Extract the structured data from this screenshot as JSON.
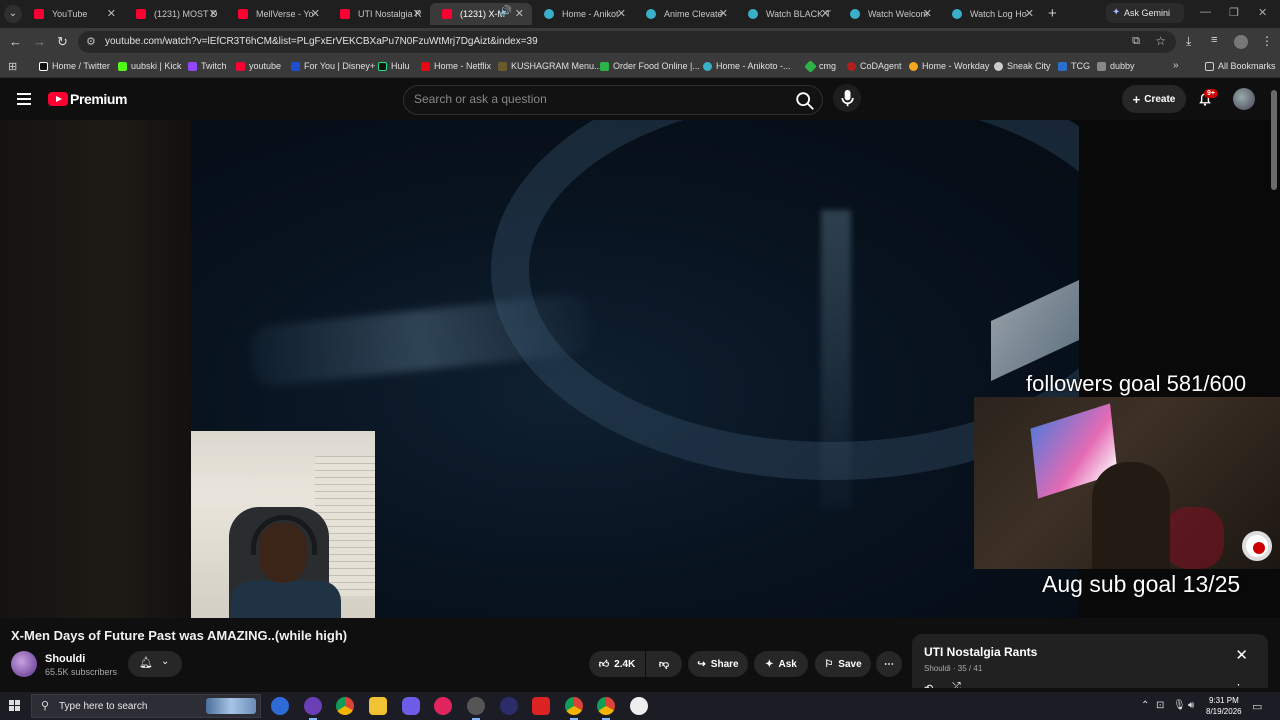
{
  "browser": {
    "tabs": [
      {
        "label": "YouTube",
        "favicon": "youtube-icon",
        "active": false
      },
      {
        "label": "(1231) MOST D",
        "favicon": "youtube-icon",
        "active": false
      },
      {
        "label": "MellVerse - Yo",
        "favicon": "youtube-icon",
        "active": false
      },
      {
        "label": "UTI Nostalgia R",
        "favicon": "youtube-icon",
        "active": false
      },
      {
        "label": "(1231) X-M",
        "favicon": "youtube-icon",
        "active": true
      },
      {
        "label": "Home - Anikot",
        "favicon": "anikoto-icon",
        "active": false
      },
      {
        "label": "Anime Clevate",
        "favicon": "anikoto-icon",
        "active": false
      },
      {
        "label": "Watch BLACK T",
        "favicon": "anikoto-icon",
        "active": false
      },
      {
        "label": "Watch Welcom",
        "favicon": "anikoto-icon",
        "active": false
      },
      {
        "label": "Watch Log Ho",
        "favicon": "anikoto-icon",
        "active": false
      }
    ],
    "gemini_label": "Ask Gemini",
    "url": "youtube.com/watch?v=lEfCR3T6hCM&list=PLgFxErVEKCBXaPu7N0FzuWtMrj7DgAizt&index=39",
    "bookmarks": [
      {
        "label": "Home / Twitter",
        "color": "#ffffff"
      },
      {
        "label": "uubski | Kick",
        "color": "#53fc18"
      },
      {
        "label": "Twitch",
        "color": "#9146ff"
      },
      {
        "label": "youtube",
        "color": "#ff0033"
      },
      {
        "label": "For You | Disney+",
        "color": "#1f4fd0"
      },
      {
        "label": "Hulu",
        "color": "#1ce783"
      },
      {
        "label": "Home - Netflix",
        "color": "#e50914"
      },
      {
        "label": "KUSHAGRAM Menu...",
        "color": "#6b5a2a"
      },
      {
        "label": "Order Food Online |...",
        "color": "#2cb34a"
      },
      {
        "label": "Home - Anikoto -...",
        "color": "#3ab0c8"
      },
      {
        "label": "cmg",
        "color": "#2cb34a"
      },
      {
        "label": "CoDAgent",
        "color": "#b01e1e"
      },
      {
        "label": "Home - Workday",
        "color": "#f5a623"
      },
      {
        "label": "Sneak City",
        "color": "#cccccc"
      },
      {
        "label": "TCG",
        "color": "#2a6fd0"
      },
      {
        "label": "dubby",
        "color": "#888888"
      }
    ],
    "all_bookmarks_label": "All Bookmarks"
  },
  "youtube": {
    "logo_text": "Premium",
    "search_placeholder": "Search or ask a question",
    "create_label": "Create",
    "notification_count": "9+"
  },
  "player": {
    "overlay_followers": "followers goal 581/600",
    "overlay_sub_goal": "Aug sub goal 13/25"
  },
  "video": {
    "title": "X-Men Days of Future Past was AMAZING..(while high)",
    "channel_name": "Shouldi",
    "subscribers": "65.5K subscribers",
    "likes": "2.4K",
    "share_label": "Share",
    "ask_label": "Ask",
    "save_label": "Save"
  },
  "playlist": {
    "title": "UTI Nostalgia Rants",
    "meta": "Shouldi · 35 / 41"
  },
  "taskbar": {
    "search_label": "Type here to search",
    "time": "9:31 PM",
    "date": "8/19/2026"
  },
  "colors": {
    "youtube_red": "#ff0033",
    "page_bg": "#0f0f0f",
    "chip_bg": "#272727"
  }
}
